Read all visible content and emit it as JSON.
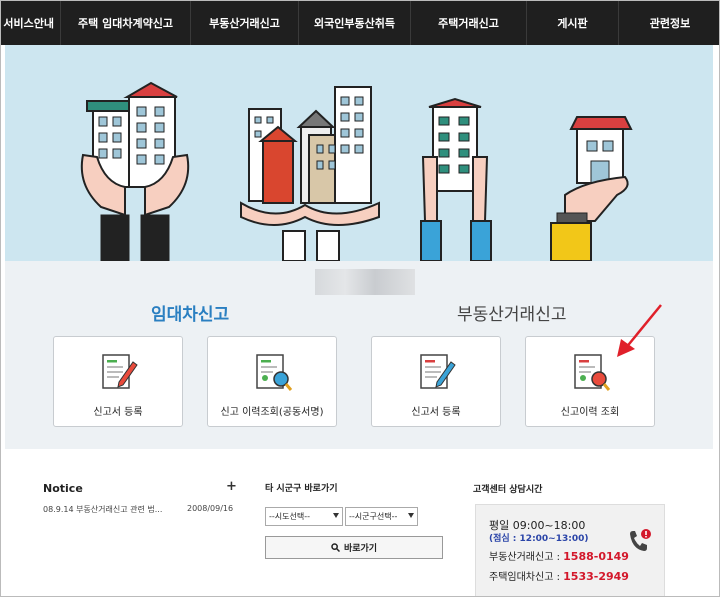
{
  "nav": {
    "items": [
      "서비스안내",
      "주택 임대차계약신고",
      "부동산거래신고",
      "외국인부동산취득",
      "주택거래신고",
      "게시판",
      "관련정보"
    ]
  },
  "sections": {
    "lease_title": "임대차신고",
    "realestate_title": "부동산거래신고"
  },
  "cards": [
    {
      "label": "신고서 등록",
      "icon": "form-pencil-icon"
    },
    {
      "label": "신고 이력조회(공동서명)",
      "icon": "form-search-icon"
    },
    {
      "label": "신고서 등록",
      "icon": "form-pencil-icon"
    },
    {
      "label": "신고이력 조회",
      "icon": "form-search-icon"
    }
  ],
  "notice": {
    "title": "Notice",
    "more": "+",
    "rows": [
      {
        "text": "08.9.14 부동산거래신고 관련 법...",
        "date": "2008/09/16"
      }
    ]
  },
  "shortcut": {
    "title": "타 시군구 바로가기",
    "sido_select": "--시도선택--",
    "sigungu_select": "--시군구선택--",
    "go_label": "바로가기"
  },
  "customer_center": {
    "title": "고객센터 상담시간",
    "hours": "평일 09:00~18:00",
    "lunch": "(점심 : 12:00~13:00)",
    "realestate_label": "부동산거래신고 : ",
    "realestate_number": "1588-0149",
    "lease_label": "주택임대차신고 : ",
    "lease_number": "1533-2949"
  },
  "colors": {
    "nav_bg": "#1f1f1f",
    "hero_bg": "#cde6f0",
    "accent_blue": "#2a7fc1",
    "phone_red": "#d3182b",
    "arrow_red": "#e0202a"
  }
}
